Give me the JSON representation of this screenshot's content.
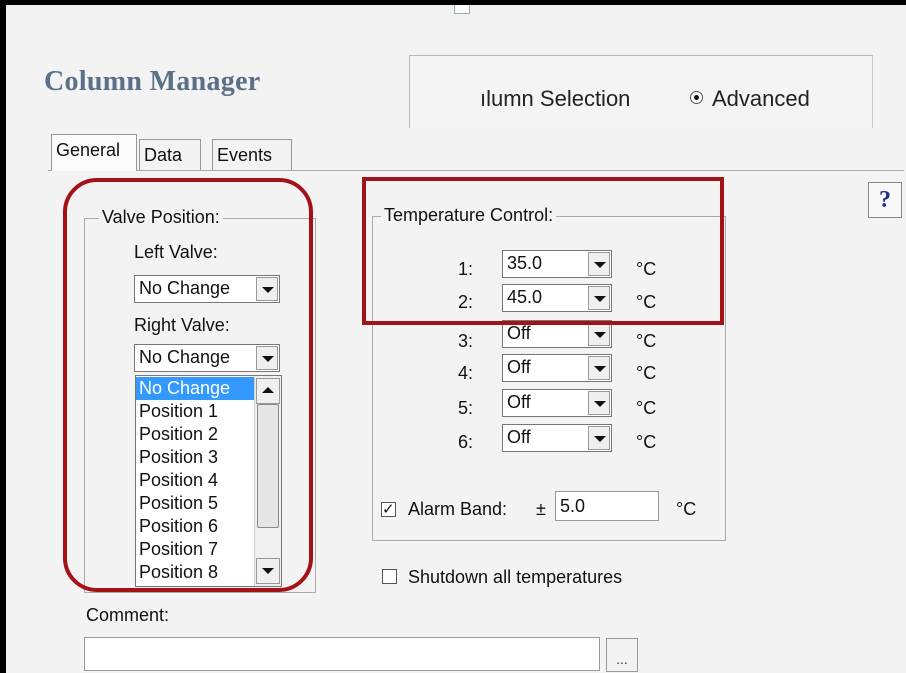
{
  "app": {
    "title": "Column Manager",
    "help_label": "?"
  },
  "mode": {
    "selection_label": "ılumn Selection",
    "advanced_label": "Advanced",
    "advanced_selected": true
  },
  "tabs": [
    {
      "label": "General",
      "active": true
    },
    {
      "label": "Data",
      "active": false
    },
    {
      "label": "Events",
      "active": false
    }
  ],
  "valve": {
    "legend": "Valve Position:",
    "left_label": "Left Valve:",
    "left_value": "No Change",
    "right_label": "Right Valve:",
    "right_value": "No Change",
    "options": [
      "No Change",
      "Position 1",
      "Position 2",
      "Position 3",
      "Position 4",
      "Position 5",
      "Position 6",
      "Position 7",
      "Position 8"
    ],
    "selected_index": 0
  },
  "temperature": {
    "legend": "Temperature Control:",
    "unit": "°C",
    "rows": [
      {
        "label": "1:",
        "value": "35.0"
      },
      {
        "label": "2:",
        "value": "45.0"
      },
      {
        "label": "3:",
        "value": "Off"
      },
      {
        "label": "4:",
        "value": "Off"
      },
      {
        "label": "5:",
        "value": "Off"
      },
      {
        "label": "6:",
        "value": "Off"
      }
    ],
    "alarm_label": "Alarm Band:",
    "alarm_checked": true,
    "alarm_prefix": "±",
    "alarm_value": "5.0",
    "alarm_unit": "°C"
  },
  "shutdown": {
    "label": "Shutdown all temperatures",
    "checked": false
  },
  "comment": {
    "label": "Comment:",
    "value": "",
    "browse_label": "..."
  },
  "colors": {
    "highlight_red": "#a31218",
    "title_blue": "#5b6f86",
    "selection_blue": "#3399ff"
  }
}
